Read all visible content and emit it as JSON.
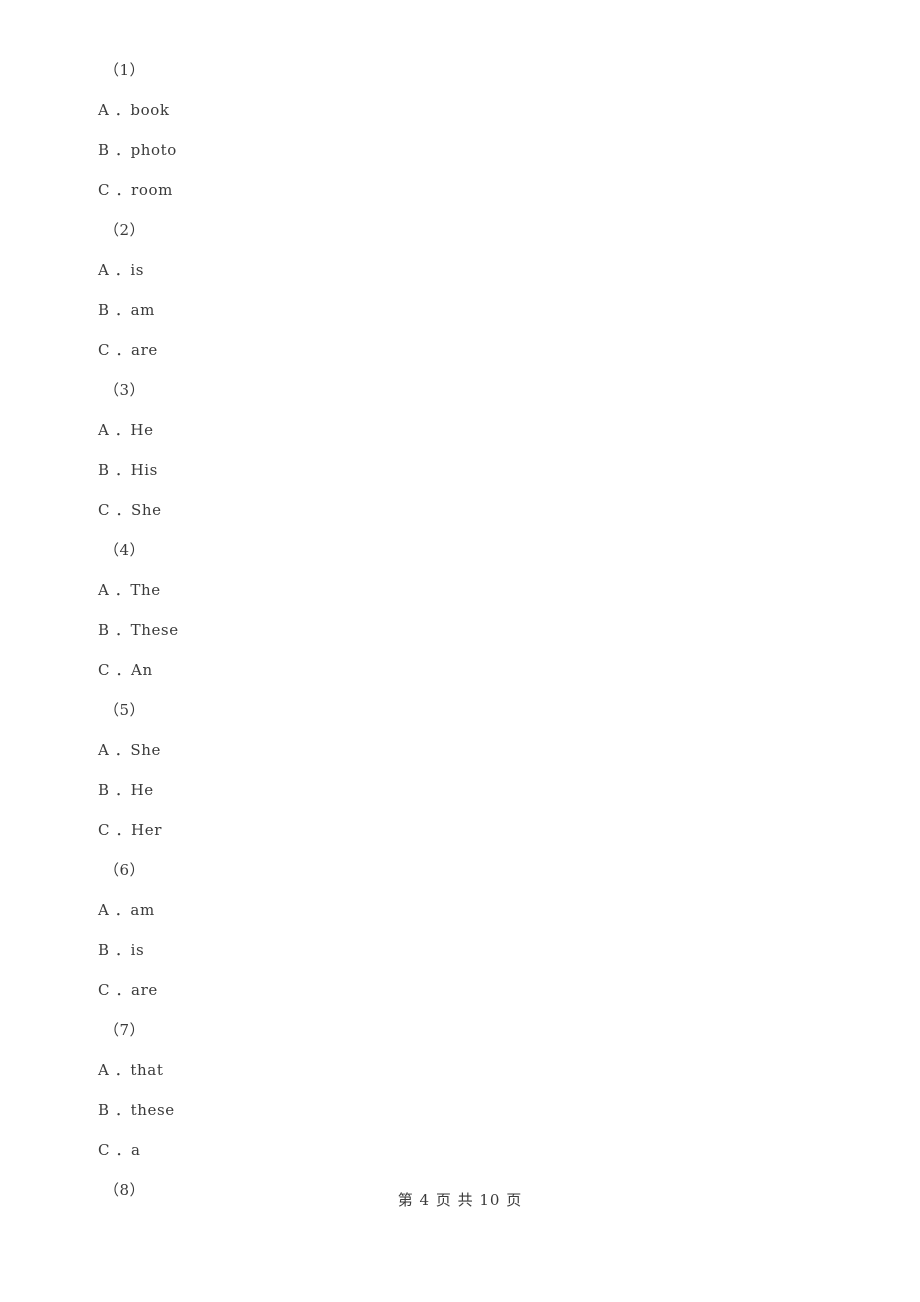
{
  "document": {
    "page_footer": "第 4 页 共 10 页"
  },
  "questions": [
    {
      "number": "（1）",
      "options": [
        {
          "label": "A ．book"
        },
        {
          "label": "B ．photo"
        },
        {
          "label": "C ．room"
        }
      ]
    },
    {
      "number": "（2）",
      "options": [
        {
          "label": "A ．is"
        },
        {
          "label": "B ．am"
        },
        {
          "label": "C ．are"
        }
      ]
    },
    {
      "number": "（3）",
      "options": [
        {
          "label": "A ．He"
        },
        {
          "label": "B ．His"
        },
        {
          "label": "C ．She"
        }
      ]
    },
    {
      "number": "（4）",
      "options": [
        {
          "label": "A ．The"
        },
        {
          "label": "B ．These"
        },
        {
          "label": "C ．An"
        }
      ]
    },
    {
      "number": "（5）",
      "options": [
        {
          "label": "A ．She"
        },
        {
          "label": "B ．He"
        },
        {
          "label": "C ．Her"
        }
      ]
    },
    {
      "number": "（6）",
      "options": [
        {
          "label": "A ．am"
        },
        {
          "label": "B ．is"
        },
        {
          "label": "C ．are"
        }
      ]
    },
    {
      "number": "（7）",
      "options": [
        {
          "label": "A ．that"
        },
        {
          "label": "B ．these"
        },
        {
          "label": "C ．a"
        }
      ]
    },
    {
      "number": "（8）",
      "options": []
    }
  ]
}
